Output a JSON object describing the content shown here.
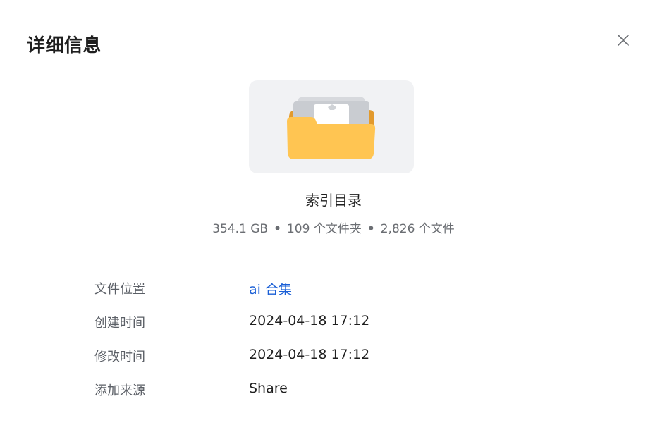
{
  "dialog": {
    "title": "详细信息",
    "close_icon": "close-icon"
  },
  "item": {
    "icon": "folder-icon",
    "name": "索引目录",
    "size": "354.1 GB",
    "folders": "109 个文件夹",
    "files": "2,826 个文件",
    "separator": "•"
  },
  "details": [
    {
      "label": "文件位置",
      "value": "ai 合集",
      "is_link": true
    },
    {
      "label": "创建时间",
      "value": "2024-04-18 17:12",
      "is_link": false
    },
    {
      "label": "修改时间",
      "value": "2024-04-18 17:12",
      "is_link": false
    },
    {
      "label": "添加来源",
      "value": "Share",
      "is_link": false
    }
  ],
  "colors": {
    "link": "#1a5fd6",
    "folder": "#ffc552",
    "folder_back": "#e29a2d",
    "thumb_bg": "#f1f2f4"
  }
}
